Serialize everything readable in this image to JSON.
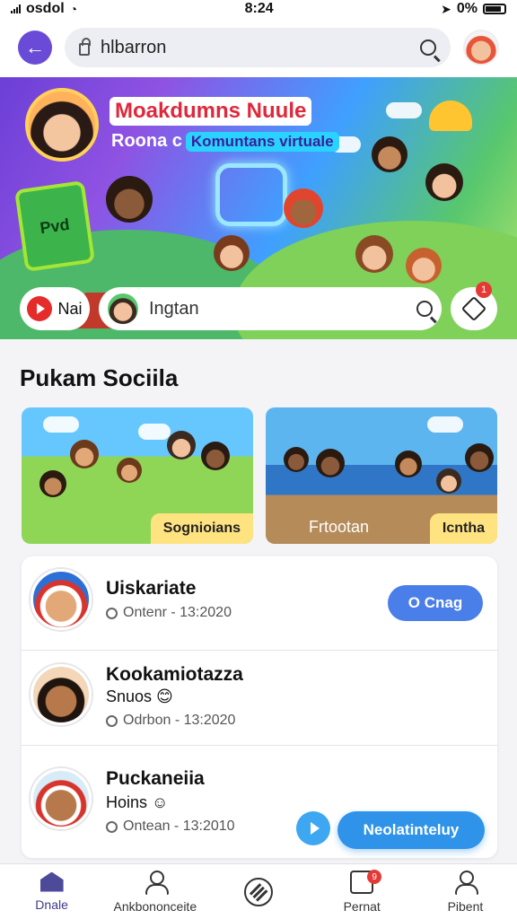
{
  "status_bar": {
    "carrier": "osdol",
    "time": "8:24",
    "battery": "0%"
  },
  "header": {
    "search_text": "hlbarron"
  },
  "hero": {
    "title": "Moakdumns Nuule",
    "subtitle_prefix": "Roona c",
    "subtitle_pill": "Komuntans virtuale",
    "board_text": "Pvd",
    "youtube_chip_label": "Nai",
    "search_placeholder": "Ingtan",
    "alert_badge": "1"
  },
  "section": {
    "title": "Pukam Sociila",
    "cards": [
      {
        "label": "Sognioians"
      },
      {
        "left_label": "Frtootan",
        "label": "Icntha"
      }
    ]
  },
  "list": {
    "items": [
      {
        "name": "Uiskariate",
        "meta": "Ontenr - 13:2020",
        "action": "O Cnag"
      },
      {
        "name": "Kookamiotazza",
        "subtitle": "Snuos 😊",
        "meta": "Odrbon - 13:2020"
      },
      {
        "name": "Puckaneiia",
        "subtitle": "Hoins ☺",
        "meta": "Ontean - 13:2010"
      }
    ],
    "primary_button": "Neolatinteluy"
  },
  "bottom_nav": {
    "items": [
      {
        "label": "Dnale",
        "icon": "home-icon"
      },
      {
        "label": "Ankbononceite",
        "icon": "person-icon"
      },
      {
        "label": "",
        "icon": "compass-icon"
      },
      {
        "label": "Pernat",
        "icon": "post-icon",
        "badge": "9"
      },
      {
        "label": "Pibent",
        "icon": "person-icon"
      }
    ]
  },
  "colors": {
    "accent": "#6a4bd8",
    "primary": "#2f93ea",
    "alert": "#e53935"
  }
}
